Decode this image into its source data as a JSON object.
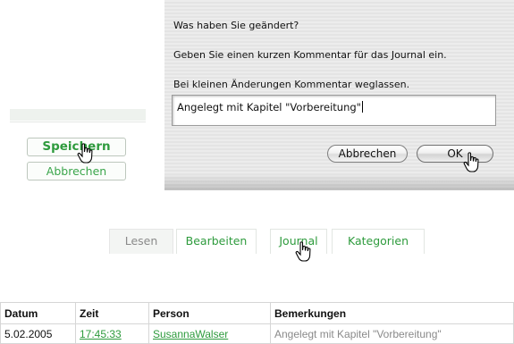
{
  "form": {
    "save_label": "Speichern",
    "cancel_label": "Abbrechen"
  },
  "dialog": {
    "question": "Was haben Sie geändert?",
    "line1": "Geben Sie einen kurzen Kommentar für das Journal ein.",
    "line2": "Bei kleinen Änderungen Kommentar weglassen.",
    "comment_value": "Angelegt mit Kapitel \"Vorbereitung\"",
    "cancel_label": "Abbrechen",
    "ok_label": "OK"
  },
  "tabs": [
    {
      "label": "Lesen",
      "active": true
    },
    {
      "label": "Bearbeiten",
      "active": false
    },
    {
      "label": "Journal",
      "active": false
    },
    {
      "label": "Kategorien",
      "active": false
    }
  ],
  "journal_table": {
    "headers": [
      "Datum",
      "Zeit",
      "Person",
      "Bemerkungen"
    ],
    "rows": [
      {
        "date": "5.02.2005",
        "time": "17:45:33",
        "person": "SusannaWalser",
        "remark": "Angelegt mit Kapitel \"Vorbereitung\""
      }
    ]
  },
  "colors": {
    "link_green": "#2e9b3d",
    "inactive_grey": "#8a8a8a"
  },
  "icons": [
    "hand-pointer-cursor-icon"
  ]
}
